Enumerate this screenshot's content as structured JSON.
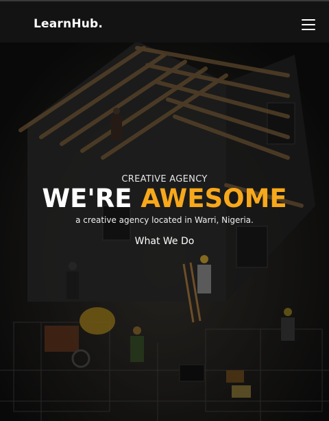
{
  "header": {
    "brand": "LearnHub.",
    "menu_icon": "hamburger-menu-icon"
  },
  "hero": {
    "eyebrow": "CREATIVE AGENCY",
    "headline_white": "WE'RE",
    "headline_accent": "AWESOME",
    "tagline": "a creative agency located in Warri, Nigeria.",
    "cta_label": "What We Do"
  },
  "colors": {
    "accent": "#f7a81b",
    "overlay": "#141414",
    "text": "#ffffff"
  }
}
